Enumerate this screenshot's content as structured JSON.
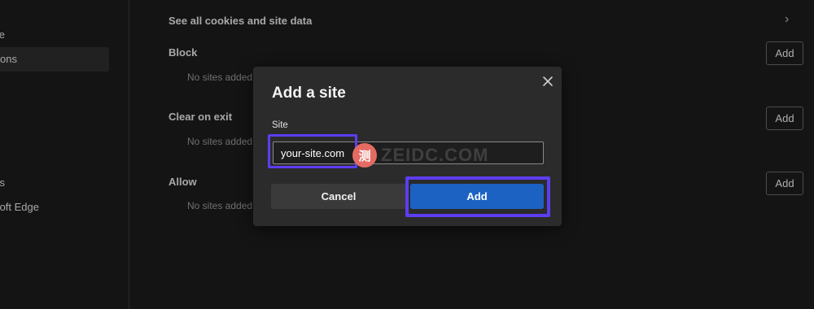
{
  "sidebar": {
    "items": [
      {
        "label": "e"
      },
      {
        "label": "ons"
      },
      {
        "label": "s"
      },
      {
        "label": "oft Edge"
      }
    ]
  },
  "main": {
    "see_all_label": "See all cookies and site data",
    "sections": [
      {
        "title": "Block",
        "empty": "No sites added",
        "add_label": "Add"
      },
      {
        "title": "Clear on exit",
        "empty": "No sites added",
        "add_label": "Add"
      },
      {
        "title": "Allow",
        "empty": "No sites added",
        "add_label": "Add"
      }
    ]
  },
  "dialog": {
    "title": "Add a site",
    "field_label": "Site",
    "site_value": "your-site.com",
    "cancel_label": "Cancel",
    "add_label": "Add"
  },
  "watermark": {
    "badge": "测",
    "text": "ZEIDC.COM"
  },
  "colors": {
    "background": "#1c1c1c",
    "dialog": "#2b2b2b",
    "primary": "#1c62c3",
    "highlight": "#5d3df0"
  }
}
